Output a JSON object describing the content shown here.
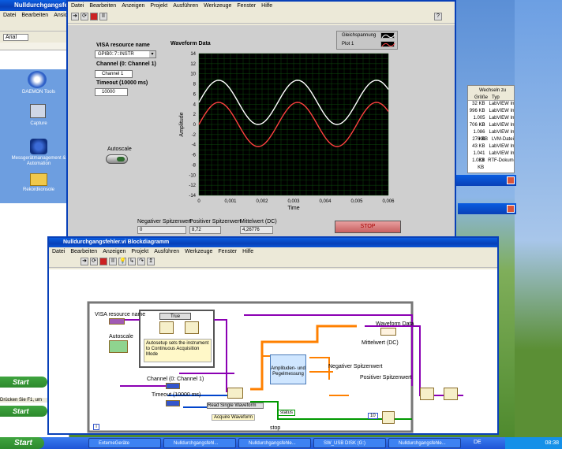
{
  "back_window": {
    "title": "Nulldurchgangsfehle",
    "menu": [
      "Datei",
      "Bearbeiten",
      "Ansicht"
    ],
    "font_field": "Arial",
    "status": "Drücken Sie F1, um"
  },
  "desktop_icons": [
    {
      "label": "DAEMON Tools",
      "icon": "daemon-icon"
    },
    {
      "label": "Capture",
      "icon": "capture-icon"
    },
    {
      "label": "Messgerätmanagement & Automation",
      "icon": "max-icon"
    },
    {
      "label": "Rekordkonsole",
      "icon": "folder-icon"
    }
  ],
  "explorer": {
    "toolbar_label": "Wechseln zu",
    "columns": [
      "Größe",
      "Typ"
    ],
    "rows": [
      [
        "32 KB",
        "LabVIEW Inst"
      ],
      [
        "996 KB",
        "LabVIEW Inst"
      ],
      [
        "1.005 KB",
        "LabVIEW Inst"
      ],
      [
        "706 KB",
        "LabVIEW Inst"
      ],
      [
        "1.086 KB",
        "LabVIEW Inst"
      ],
      [
        "276 KB",
        "LVM-Datei"
      ],
      [
        "43 KB",
        "LabVIEW Inst"
      ],
      [
        "1.041 KB",
        "LabVIEW Inst"
      ],
      [
        "1.083 KB",
        "RTF-Dokument"
      ]
    ]
  },
  "front_panel": {
    "menu": [
      "Datei",
      "Bearbeiten",
      "Anzeigen",
      "Projekt",
      "Ausführen",
      "Werkzeuge",
      "Fenster",
      "Hilfe"
    ],
    "visa_label": "VISA resource name",
    "visa_value": "GPIB0::7::INSTR",
    "channel_label": "Channel (0: Channel 1)",
    "channel_value": "Channel 1",
    "timeout_label": "Timeout (10000 ms)",
    "timeout_value": "10000",
    "autoscale_label": "Autoscale",
    "graph_title": "Waveform Data",
    "legend": [
      "Gleichspannung",
      "Plot 1"
    ],
    "neg_label": "Negativer Spitzenwert",
    "neg_value": "0",
    "pos_label": "Positiver Spitzenwert",
    "pos_value": "8,72",
    "mean_label": "Mittelwert (DC)",
    "mean_value": "4,26776",
    "stop_label": "STOP"
  },
  "chart_data": {
    "type": "line",
    "xlabel": "Time",
    "ylabel": "Amplitude",
    "xlim": [
      0,
      0.006
    ],
    "ylim": [
      -14,
      14
    ],
    "xticks": [
      "0",
      "0,001",
      "0,002",
      "0,003",
      "0,004",
      "0,005",
      "0,006"
    ],
    "yticks": [
      "14",
      "12",
      "10",
      "8",
      "6",
      "4",
      "2",
      "0",
      "-2",
      "-4",
      "-6",
      "-8",
      "-10",
      "-12",
      "-14"
    ],
    "colors": {
      "Gleichspannung": "#ffffff",
      "Plot 1": "#ff4040"
    },
    "series": [
      {
        "name": "Gleichspannung",
        "offset": 4.36,
        "amplitude": 4.36,
        "period": 0.0025
      },
      {
        "name": "Plot 1",
        "offset": 0,
        "amplitude": 4.36,
        "period": 0.0025
      }
    ]
  },
  "block_diagram": {
    "title": "Nulldurchgangsfehler.vi Blockdiagramm",
    "menu": [
      "Datei",
      "Bearbeiten",
      "Anzeigen",
      "Projekt",
      "Ausführen",
      "Werkzeuge",
      "Fenster",
      "Hilfe"
    ],
    "labels": {
      "visa": "VISA resource name",
      "true_case": "True",
      "autosetup": "Autosetup sets the instrument to Continuous Acquisition Mode",
      "autoscale": "Autoscale",
      "channel": "Channel (0: Channel 1)",
      "timeout": "Timeout (10000 ms)",
      "read": "Read Single Waveform",
      "acquire": "Acquire Waveform",
      "amp": "Amplituden- und Pegelmessung",
      "waveform": "Waveform Data",
      "mean": "Mittelwert (DC)",
      "neg": "Negativer Spitzenwert",
      "pos": "Positiver Spitzenwert",
      "status": "status",
      "stop": "stop",
      "i": "i",
      "ten": "10",
      "one": "1"
    }
  },
  "taskbar": {
    "start": "Start",
    "items": [
      "ExterneGeräte",
      "Nulldurchgangsfehl...",
      "Nulldurchgangsfehle...",
      "SW_USB DISK (G:)",
      "Nulldurchgangsfehle..."
    ],
    "lang": "DE",
    "clock": "08:38"
  }
}
